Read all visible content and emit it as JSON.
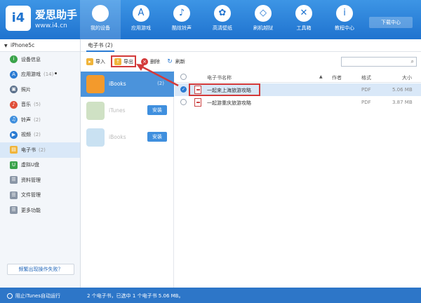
{
  "header": {
    "logo_text": "i4",
    "brand": "爱思助手",
    "url": "www.i4.cn",
    "nav": [
      {
        "label": "我的设备",
        "icon": "apple-icon",
        "glyph": ""
      },
      {
        "label": "应用游戏",
        "icon": "app-store-icon",
        "glyph": "A"
      },
      {
        "label": "酷炫铃声",
        "icon": "bell-icon",
        "glyph": "♪"
      },
      {
        "label": "高清壁纸",
        "icon": "flower-icon",
        "glyph": "✿"
      },
      {
        "label": "刷机越狱",
        "icon": "box-icon",
        "glyph": "◇"
      },
      {
        "label": "工具箱",
        "icon": "tools-icon",
        "glyph": "✕"
      },
      {
        "label": "教程中心",
        "icon": "info-icon",
        "glyph": "i"
      }
    ],
    "download_center": "下载中心"
  },
  "sidebar": {
    "device": "iPhone5c",
    "items": [
      {
        "label": "设备信息",
        "count": "",
        "color": "#3aa34a"
      },
      {
        "label": "应用游戏",
        "count": "(14)",
        "color": "#2a7bd3"
      },
      {
        "label": "照片",
        "count": "",
        "color": "#5a6f8a"
      },
      {
        "label": "音乐",
        "count": "(5)",
        "color": "#e0503a"
      },
      {
        "label": "铃声",
        "count": "(2)",
        "color": "#3f8fde"
      },
      {
        "label": "视频",
        "count": "(2)",
        "color": "#2a7bd3"
      },
      {
        "label": "电子书",
        "count": "(2)",
        "color": "#f0b43a"
      },
      {
        "label": "虚拟U盘",
        "count": "",
        "color": "#3aa34a"
      },
      {
        "label": "资料管理",
        "count": "",
        "color": "#8a96a6"
      },
      {
        "label": "文件管理",
        "count": "",
        "color": "#8a96a6"
      },
      {
        "label": "更多功能",
        "count": "",
        "color": "#8a96a6"
      }
    ],
    "help": "频繁出现操作失败？"
  },
  "content": {
    "tab": "电子书 (2)",
    "toolbar": {
      "import": "导入",
      "export": "导出",
      "delete": "删除",
      "refresh": "刷新"
    },
    "sources": [
      {
        "name": "iBooks",
        "count": "(2)",
        "color": "#f39a2c"
      },
      {
        "name": "iTunes",
        "action": "安装",
        "color": "#cfe1c4"
      },
      {
        "name": "iBooks",
        "action": "安装",
        "color": "#c9e1f2"
      }
    ],
    "columns": {
      "name": "电子书名称",
      "author": "作者",
      "format": "格式",
      "size": "大小"
    },
    "rows": [
      {
        "name": "一起来上海旅游攻略",
        "author": "",
        "format": "PDF",
        "size": "5.06 MB",
        "selected": true
      },
      {
        "name": "一起游重庆旅游攻略",
        "author": "",
        "format": "PDF",
        "size": "3.87 MB",
        "selected": false
      }
    ]
  },
  "status": {
    "left": "阻止iTunes自动运行",
    "right": "2 个电子书，已选中 1 个电子书 5.06 MB。"
  }
}
